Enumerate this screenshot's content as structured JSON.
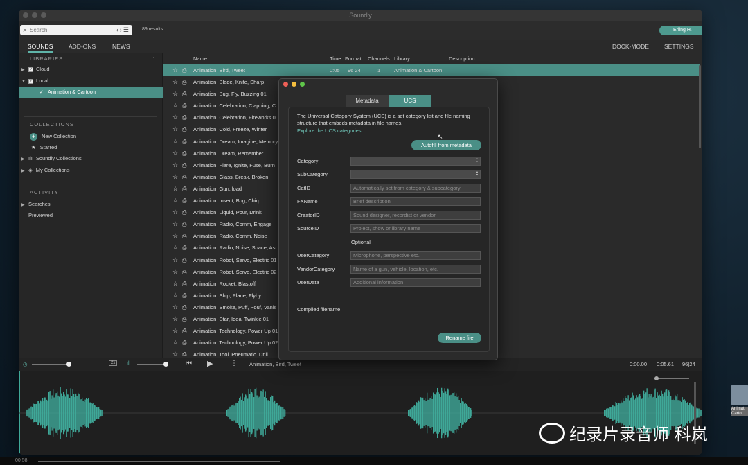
{
  "app": {
    "title": "Soundly",
    "results": "89 results",
    "user": "Erling H."
  },
  "search": {
    "placeholder": "Search"
  },
  "tabs": {
    "sounds": "SOUNDS",
    "addons": "ADD-ONS",
    "news": "NEWS",
    "dock": "DOCK-MODE",
    "settings": "SETTINGS"
  },
  "sidebar": {
    "libraries_title": "LIBRARIES",
    "cloud": "Cloud",
    "local": "Local",
    "anim": "Animation & Cartoon",
    "collections_title": "COLLECTIONS",
    "new_collection": "New Collection",
    "starred": "Starred",
    "soundly_collections": "Soundly Collections",
    "my_collections": "My Collections",
    "activity_title": "ACTIVITY",
    "searches": "Searches",
    "previewed": "Previewed"
  },
  "columns": {
    "name": "Name",
    "time": "Time",
    "format": "Format",
    "channels": "Channels",
    "library": "Library",
    "description": "Description"
  },
  "rows": [
    {
      "name": "Animation, Bird, Tweet",
      "time": "0:05",
      "format": "96 24",
      "channels": "1",
      "library": "Animation & Cartoon"
    },
    {
      "name": "Animation, Blade, Knife, Sharp"
    },
    {
      "name": "Animation, Bug, Fly, Buzzing 01"
    },
    {
      "name": "Animation, Celebration, Clapping, C"
    },
    {
      "name": "Animation, Celebration, Fireworks 0"
    },
    {
      "name": "Animation, Cold, Freeze, Winter"
    },
    {
      "name": "Animation, Dream, Imagine, Memory"
    },
    {
      "name": "Animation, Dream, Remember"
    },
    {
      "name": "Animation, Flare, Ignite, Fuse, Burn"
    },
    {
      "name": "Animation, Glass, Break, Broken"
    },
    {
      "name": "Animation, Gun, load"
    },
    {
      "name": "Animation, Insect, Bug, Chirp"
    },
    {
      "name": "Animation, Liquid, Pour, Drink"
    },
    {
      "name": "Animation, Radio, Comm, Engage"
    },
    {
      "name": "Animation, Radio, Comm, Noise"
    },
    {
      "name": "Animation, Radio, Noise, Space, Ast"
    },
    {
      "name": "Animation, Robot, Servo, Electric 01"
    },
    {
      "name": "Animation, Robot, Servo, Electric 02"
    },
    {
      "name": "Animation, Rocket, Blastoff"
    },
    {
      "name": "Animation, Ship, Plane, Flyby"
    },
    {
      "name": "Animation, Smoke, Puff, Pouf, Vanis"
    },
    {
      "name": "Animation, Star, Idea, Twinkle 01"
    },
    {
      "name": "Animation, Technology, Power Up 01"
    },
    {
      "name": "Animation, Technology, Power Up 02"
    },
    {
      "name": "Animation, Tool, Pneumatic, Drill"
    }
  ],
  "player": {
    "now_playing": "Animation, Bird, Tweet",
    "pos": "0:00.00",
    "dur": "0:05.61",
    "fmt": "96|24",
    "speed": "2x"
  },
  "modal": {
    "tab_metadata": "Metadata",
    "tab_ucs": "UCS",
    "intro": "The Universal Category System (UCS) is a set category list and file naming structure that embeds metadata in file names.",
    "link": "Explore the UCS categories",
    "autofill": "Autofill from metadata",
    "category": "Category",
    "subcategory": "SubCategory",
    "catid": "CatID",
    "catid_ph": "Automatically set from category & subcategory",
    "fxname": "FXName",
    "fxname_ph": "Brief description",
    "creatorid": "CreatorID",
    "creatorid_ph": "Sound designer, recordist or vendor",
    "sourceid": "SourceID",
    "sourceid_ph": "Project, show or library name",
    "optional": "Optional",
    "usercategory": "UserCategory",
    "usercategory_ph": "Microphone, perspective etc.",
    "vendorcategory": "VendorCategory",
    "vendorcategory_ph": "Name of a gun, vehicle, location, etc.",
    "userdata": "UserData",
    "userdata_ph": "Additional information",
    "compiled": "Compiled filename",
    "rename": "Rename file"
  },
  "footer": {
    "time": "00:58"
  },
  "watermark": "纪录片录音师 科岚",
  "desktop_icon": "Animat Carto",
  "colors": {
    "accent": "#4a8f86",
    "wave": "#3fa898"
  }
}
